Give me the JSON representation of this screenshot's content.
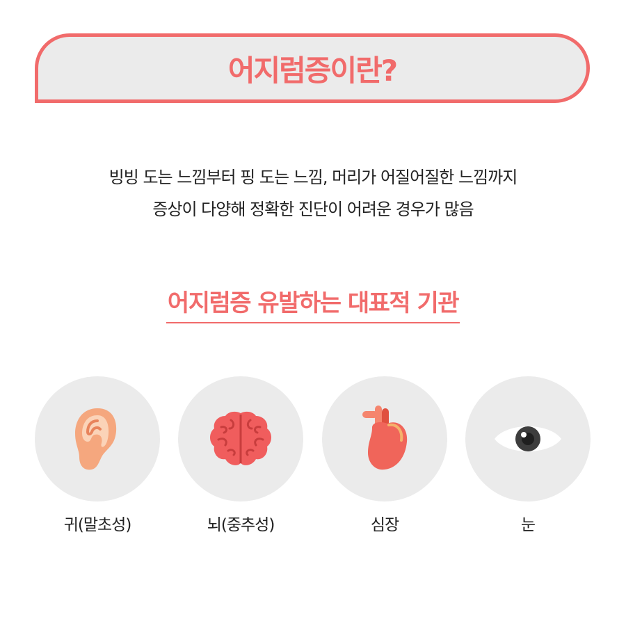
{
  "title": "어지럼증이란?",
  "description": {
    "line1": "빙빙 도는 느낌부터 핑 도는 느낌, 머리가 어질어질한 느낌까지",
    "line2": "증상이 다양해 정확한 진단이 어려운 경우가 많음"
  },
  "subtitle": "어지럼증 유발하는 대표적 기관",
  "organs": [
    {
      "icon": "ear-icon",
      "label": "귀(말초성)"
    },
    {
      "icon": "brain-icon",
      "label": "뇌(중추성)"
    },
    {
      "icon": "heart-icon",
      "label": "심장"
    },
    {
      "icon": "eye-icon",
      "label": "눈"
    }
  ],
  "colors": {
    "accent": "#f16b6b",
    "banner_bg": "#ebebeb",
    "circle_bg": "#ebebeb",
    "text": "#222222"
  }
}
